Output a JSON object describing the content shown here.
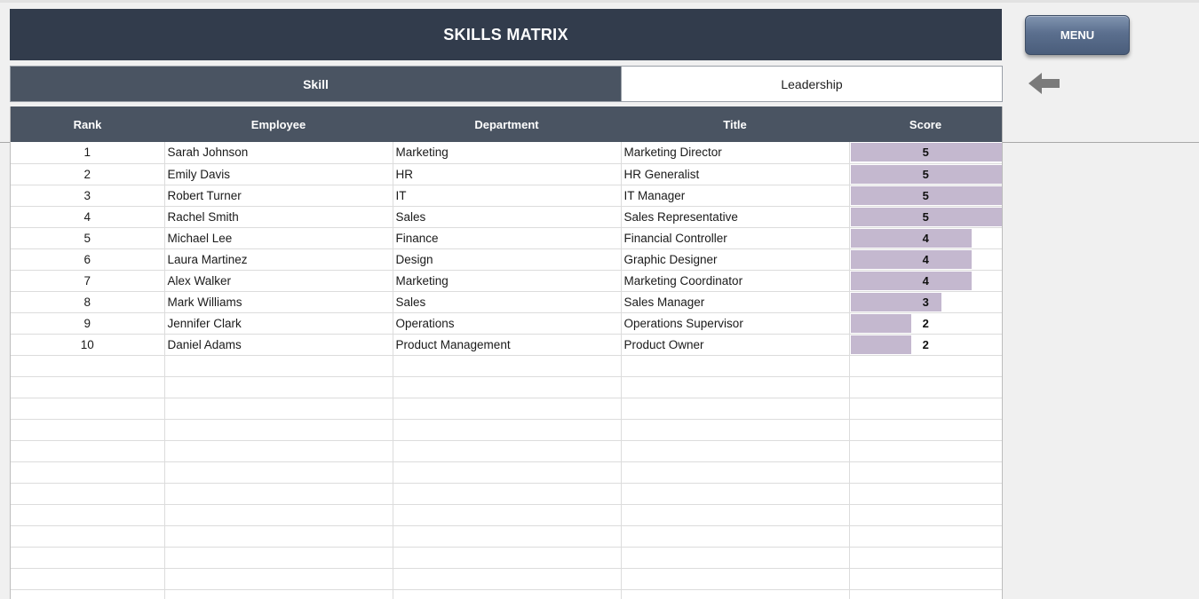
{
  "header": {
    "title": "SKILLS MATRIX"
  },
  "tabs": [
    {
      "label": "Skill",
      "active": true
    },
    {
      "label": "Leadership",
      "active": false
    }
  ],
  "menu_button": {
    "label": "MENU"
  },
  "icons": {
    "back": "left-arrow-icon"
  },
  "colors": {
    "header_bg": "#323c4c",
    "table_header_bg": "#4a5462",
    "score_bar": "#c4b8cf",
    "menu_button": "#5b6f8e"
  },
  "table": {
    "columns": [
      "Rank",
      "Employee",
      "Department",
      "Title",
      "Score"
    ],
    "max_score": 5,
    "rows": [
      {
        "rank": "1",
        "employee": "Sarah Johnson",
        "department": "Marketing",
        "title": "Marketing Director",
        "score": 5
      },
      {
        "rank": "2",
        "employee": "Emily Davis",
        "department": "HR",
        "title": "HR Generalist",
        "score": 5
      },
      {
        "rank": "3",
        "employee": "Robert Turner",
        "department": "IT",
        "title": "IT Manager",
        "score": 5
      },
      {
        "rank": "4",
        "employee": "Rachel Smith",
        "department": "Sales",
        "title": "Sales Representative",
        "score": 5
      },
      {
        "rank": "5",
        "employee": "Michael Lee",
        "department": "Finance",
        "title": "Financial Controller",
        "score": 4
      },
      {
        "rank": "6",
        "employee": "Laura Martinez",
        "department": "Design",
        "title": "Graphic Designer",
        "score": 4
      },
      {
        "rank": "7",
        "employee": "Alex Walker",
        "department": "Marketing",
        "title": "Marketing Coordinator",
        "score": 4
      },
      {
        "rank": "8",
        "employee": "Mark Williams",
        "department": "Sales",
        "title": "Sales Manager",
        "score": 3
      },
      {
        "rank": "9",
        "employee": "Jennifer Clark",
        "department": "Operations",
        "title": "Operations Supervisor",
        "score": 2
      },
      {
        "rank": "10",
        "employee": "Daniel Adams",
        "department": "Product Management",
        "title": "Product Owner",
        "score": 2
      }
    ],
    "empty_rows": 12
  }
}
